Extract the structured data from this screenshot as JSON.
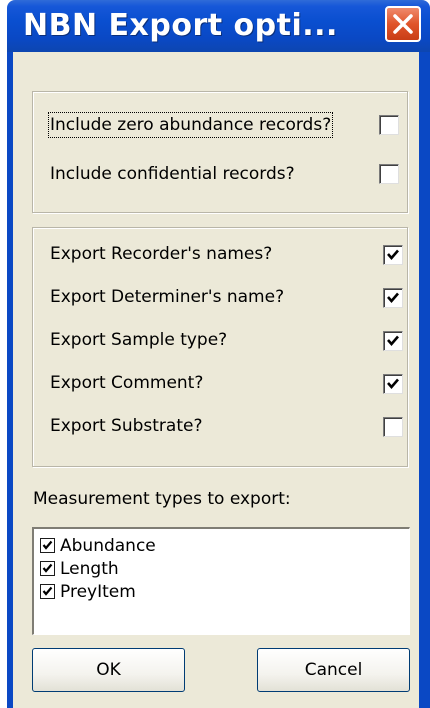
{
  "window": {
    "title": "NBN Export opti...",
    "close_icon": "close-icon"
  },
  "group1": [
    {
      "label": "Include zero abundance records?",
      "checked": false,
      "focused": true
    },
    {
      "label": "Include confidential records?",
      "checked": false,
      "focused": false
    }
  ],
  "group2": [
    {
      "label": "Export Recorder's names?",
      "checked": true
    },
    {
      "label": "Export Determiner's name?",
      "checked": true
    },
    {
      "label": "Export Sample type?",
      "checked": true
    },
    {
      "label": "Export Comment?",
      "checked": true
    },
    {
      "label": "Export Substrate?",
      "checked": false
    }
  ],
  "measurements": {
    "label": "Measurement types to export:",
    "items": [
      {
        "label": "Abundance",
        "checked": true
      },
      {
        "label": "Length",
        "checked": true
      },
      {
        "label": "PreyItem",
        "checked": true
      }
    ]
  },
  "buttons": {
    "ok": "OK",
    "cancel": "Cancel"
  },
  "colors": {
    "titlebar": "#0a48c4",
    "face": "#ece9d8",
    "close": "#e0542a"
  }
}
